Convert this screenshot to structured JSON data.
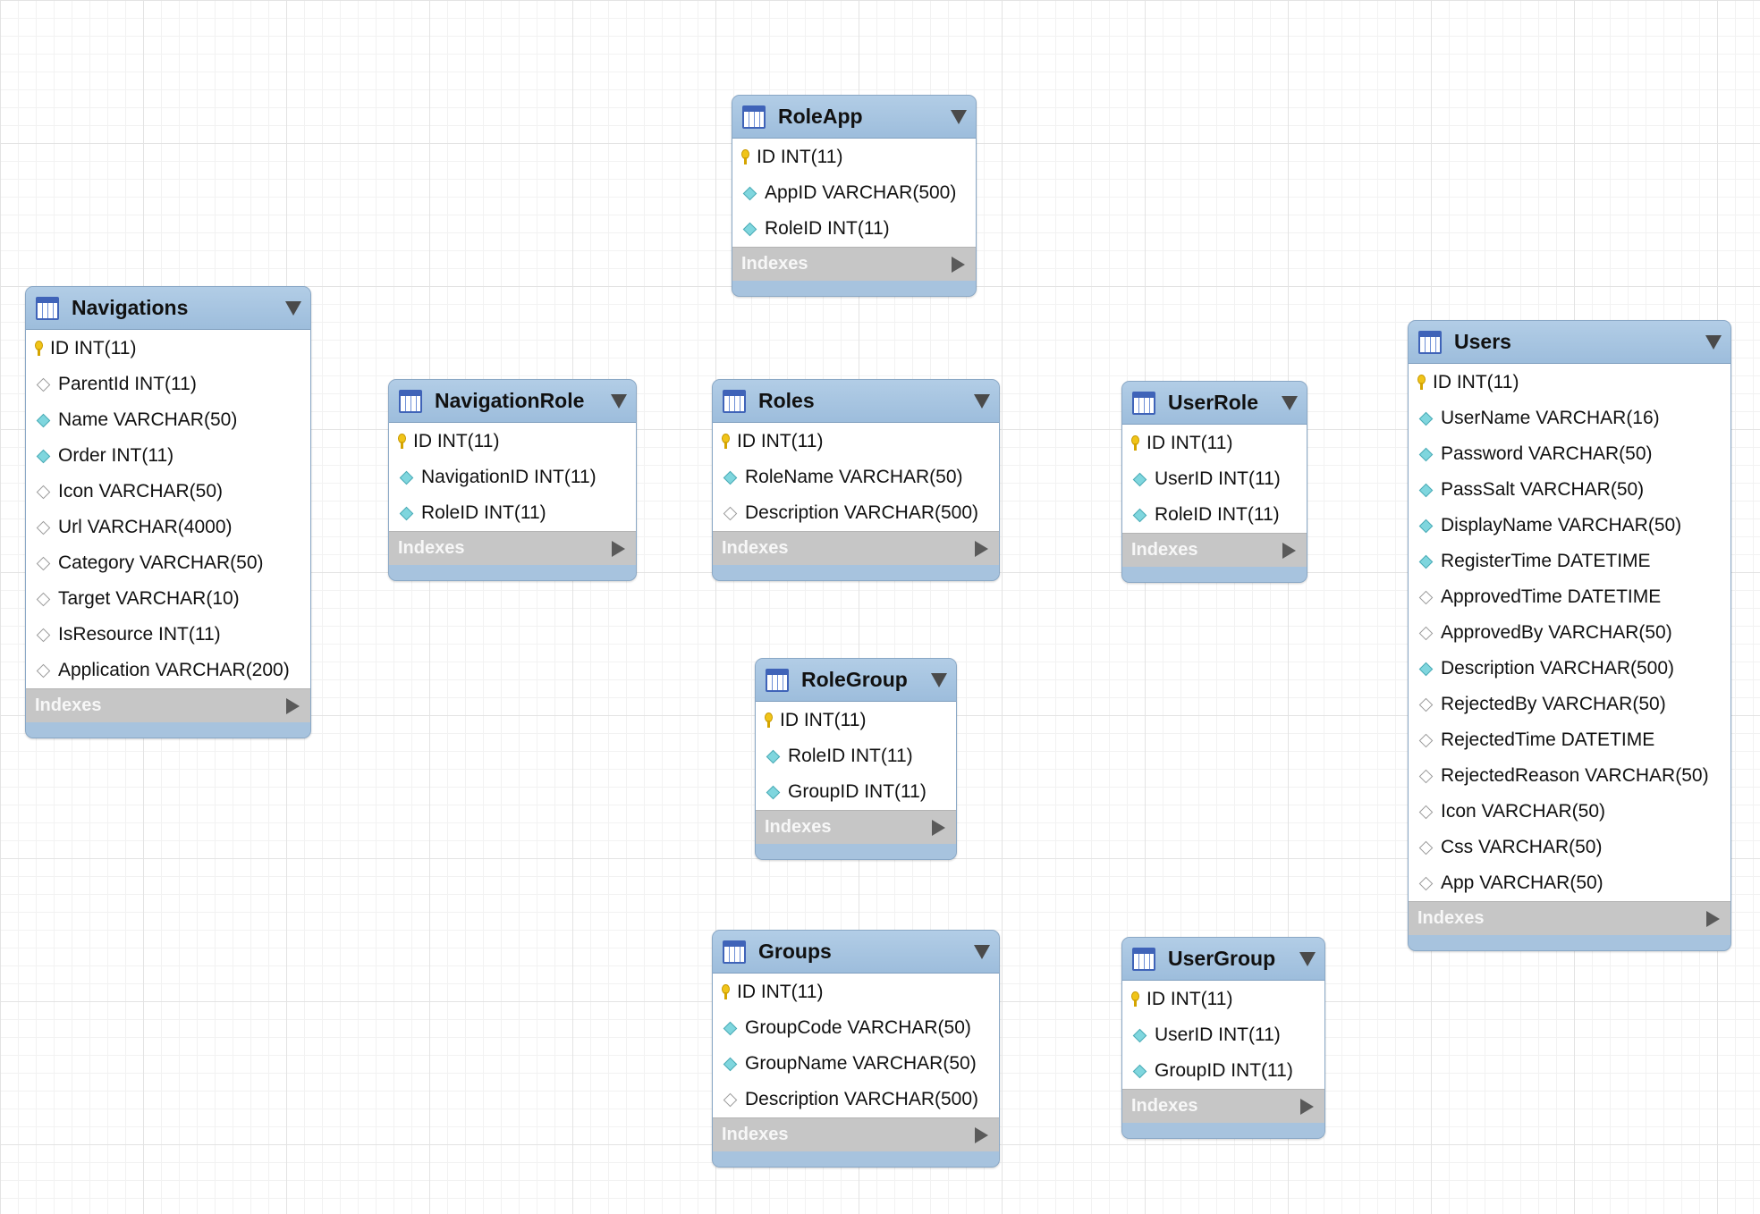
{
  "tables": [
    {
      "id": "roleapp",
      "name": "RoleApp",
      "indexes_label": "Indexes",
      "columns": [
        {
          "text": "ID INT(11)",
          "kind": "key"
        },
        {
          "text": "AppID VARCHAR(500)",
          "kind": "filled"
        },
        {
          "text": "RoleID INT(11)",
          "kind": "filled"
        }
      ]
    },
    {
      "id": "navigations",
      "name": "Navigations",
      "indexes_label": "Indexes",
      "columns": [
        {
          "text": "ID INT(11)",
          "kind": "key"
        },
        {
          "text": "ParentId INT(11)",
          "kind": "empty"
        },
        {
          "text": "Name VARCHAR(50)",
          "kind": "filled"
        },
        {
          "text": "Order INT(11)",
          "kind": "filled"
        },
        {
          "text": "Icon VARCHAR(50)",
          "kind": "empty"
        },
        {
          "text": "Url VARCHAR(4000)",
          "kind": "empty"
        },
        {
          "text": "Category VARCHAR(50)",
          "kind": "empty"
        },
        {
          "text": "Target VARCHAR(10)",
          "kind": "empty"
        },
        {
          "text": "IsResource INT(11)",
          "kind": "empty"
        },
        {
          "text": "Application VARCHAR(200)",
          "kind": "empty"
        }
      ]
    },
    {
      "id": "navigationrole",
      "name": "NavigationRole",
      "indexes_label": "Indexes",
      "columns": [
        {
          "text": "ID INT(11)",
          "kind": "key"
        },
        {
          "text": "NavigationID INT(11)",
          "kind": "filled"
        },
        {
          "text": "RoleID INT(11)",
          "kind": "filled"
        }
      ]
    },
    {
      "id": "roles",
      "name": "Roles",
      "indexes_label": "Indexes",
      "columns": [
        {
          "text": "ID INT(11)",
          "kind": "key"
        },
        {
          "text": "RoleName VARCHAR(50)",
          "kind": "filled"
        },
        {
          "text": "Description VARCHAR(500)",
          "kind": "empty"
        }
      ]
    },
    {
      "id": "userrole",
      "name": "UserRole",
      "indexes_label": "Indexes",
      "columns": [
        {
          "text": "ID INT(11)",
          "kind": "key"
        },
        {
          "text": "UserID INT(11)",
          "kind": "filled"
        },
        {
          "text": "RoleID INT(11)",
          "kind": "filled"
        }
      ]
    },
    {
      "id": "users",
      "name": "Users",
      "indexes_label": "Indexes",
      "columns": [
        {
          "text": "ID INT(11)",
          "kind": "key"
        },
        {
          "text": "UserName VARCHAR(16)",
          "kind": "filled"
        },
        {
          "text": "Password VARCHAR(50)",
          "kind": "filled"
        },
        {
          "text": "PassSalt VARCHAR(50)",
          "kind": "filled"
        },
        {
          "text": "DisplayName VARCHAR(50)",
          "kind": "filled"
        },
        {
          "text": "RegisterTime DATETIME",
          "kind": "filled"
        },
        {
          "text": "ApprovedTime DATETIME",
          "kind": "empty"
        },
        {
          "text": "ApprovedBy VARCHAR(50)",
          "kind": "empty"
        },
        {
          "text": "Description VARCHAR(500)",
          "kind": "filled"
        },
        {
          "text": "RejectedBy VARCHAR(50)",
          "kind": "empty"
        },
        {
          "text": "RejectedTime DATETIME",
          "kind": "empty"
        },
        {
          "text": "RejectedReason VARCHAR(50)",
          "kind": "empty"
        },
        {
          "text": "Icon VARCHAR(50)",
          "kind": "empty"
        },
        {
          "text": "Css VARCHAR(50)",
          "kind": "empty"
        },
        {
          "text": "App VARCHAR(50)",
          "kind": "empty"
        }
      ]
    },
    {
      "id": "rolegroup",
      "name": "RoleGroup",
      "indexes_label": "Indexes",
      "columns": [
        {
          "text": "ID INT(11)",
          "kind": "key"
        },
        {
          "text": "RoleID INT(11)",
          "kind": "filled"
        },
        {
          "text": "GroupID INT(11)",
          "kind": "filled"
        }
      ]
    },
    {
      "id": "groups",
      "name": "Groups",
      "indexes_label": "Indexes",
      "columns": [
        {
          "text": "ID INT(11)",
          "kind": "key"
        },
        {
          "text": "GroupCode VARCHAR(50)",
          "kind": "filled"
        },
        {
          "text": "GroupName VARCHAR(50)",
          "kind": "filled"
        },
        {
          "text": "Description VARCHAR(500)",
          "kind": "empty"
        }
      ]
    },
    {
      "id": "usergroup",
      "name": "UserGroup",
      "indexes_label": "Indexes",
      "columns": [
        {
          "text": "ID INT(11)",
          "kind": "key"
        },
        {
          "text": "UserID INT(11)",
          "kind": "filled"
        },
        {
          "text": "GroupID INT(11)",
          "kind": "filled"
        }
      ]
    }
  ]
}
